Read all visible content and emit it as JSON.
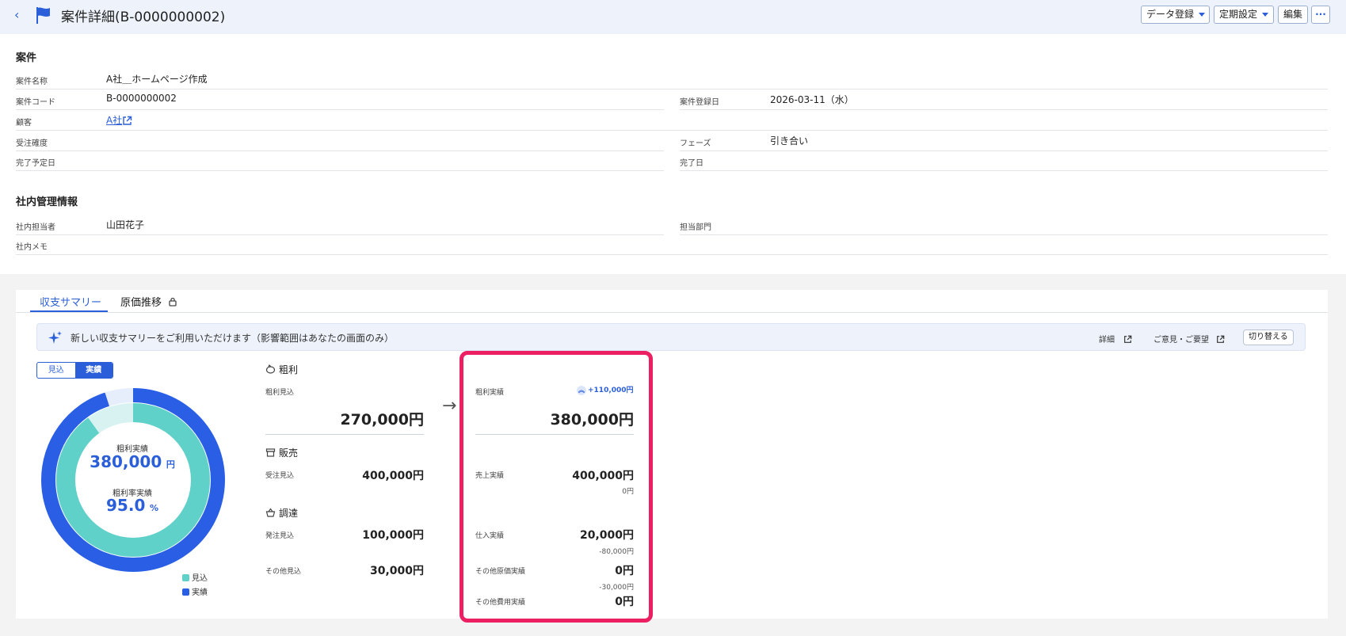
{
  "header": {
    "back": "‹",
    "title": "案件詳細(B-0000000002)",
    "buttons": {
      "data_register": "データ登録",
      "periodic": "定期設定",
      "edit": "編集",
      "more": "···"
    }
  },
  "project": {
    "section_title": "案件",
    "name_label": "案件名称",
    "name_value": "A社＿ホームページ作成",
    "code_label": "案件コード",
    "code_value": "B-0000000002",
    "registered_label": "案件登録日",
    "registered_value": "2026-03-11（水）",
    "customer_label": "顧客",
    "customer_value": "A社",
    "probability_label": "受注確度",
    "probability_value": "",
    "phase_label": "フェーズ",
    "phase_value": "引き合い",
    "planned_end_label": "完了予定日",
    "planned_end_value": "",
    "end_label": "完了日",
    "end_value": ""
  },
  "internal": {
    "section_title": "社内管理情報",
    "owner_label": "社内担当者",
    "owner_value": "山田花子",
    "dept_label": "担当部門",
    "dept_value": "",
    "memo_label": "社内メモ",
    "memo_value": ""
  },
  "tabs": {
    "summary": "収支サマリー",
    "cost": "原価推移"
  },
  "notice": {
    "text": "新しい収支サマリーをご利用いただけます（影響範囲はあなたの画面のみ）",
    "detail": "詳細",
    "feedback": "ご意見・ご要望",
    "switch": "切り替える"
  },
  "toggle": {
    "forecast": "見込",
    "actual": "実績"
  },
  "donut": {
    "gp_label": "粗利実績",
    "gp_value": "380,000",
    "gp_unit": "円",
    "rate_label": "粗利率実績",
    "rate_value": "95.0",
    "rate_unit": "%",
    "legend_forecast": "見込",
    "legend_actual": "実績",
    "forecast_fraction": 0.9,
    "actual_fraction": 0.95,
    "colors": {
      "forecast": "#5fd1c9",
      "forecast_light": "#d8f2f2",
      "actual": "#2a5fe5",
      "actual_light": "#e6edfb"
    }
  },
  "summary": {
    "gross_profit": "粗利",
    "gp_forecast_label": "粗利見込",
    "gp_forecast_value": "270,000円",
    "sales": "販売",
    "order_forecast_label": "受注見込",
    "order_forecast_value": "400,000円",
    "procurement": "調達",
    "purchase_forecast_label": "発注見込",
    "purchase_forecast_value": "100,000円",
    "other_forecast_label": "その他見込",
    "other_forecast_value": "30,000円"
  },
  "actuals": {
    "gp_label": "粗利実績",
    "gp_value": "380,000円",
    "gp_diff": "+110,000円",
    "sales_label": "売上実績",
    "sales_value": "400,000円",
    "sales_diff": "0円",
    "purchase_label": "仕入実績",
    "purchase_value": "20,000円",
    "purchase_diff": "-80,000円",
    "other_cost_label": "その他原価実績",
    "other_cost_value": "0円",
    "other_cost_diff": "-30,000円",
    "other_expense_label": "その他費用実績",
    "other_expense_value": "0円"
  }
}
